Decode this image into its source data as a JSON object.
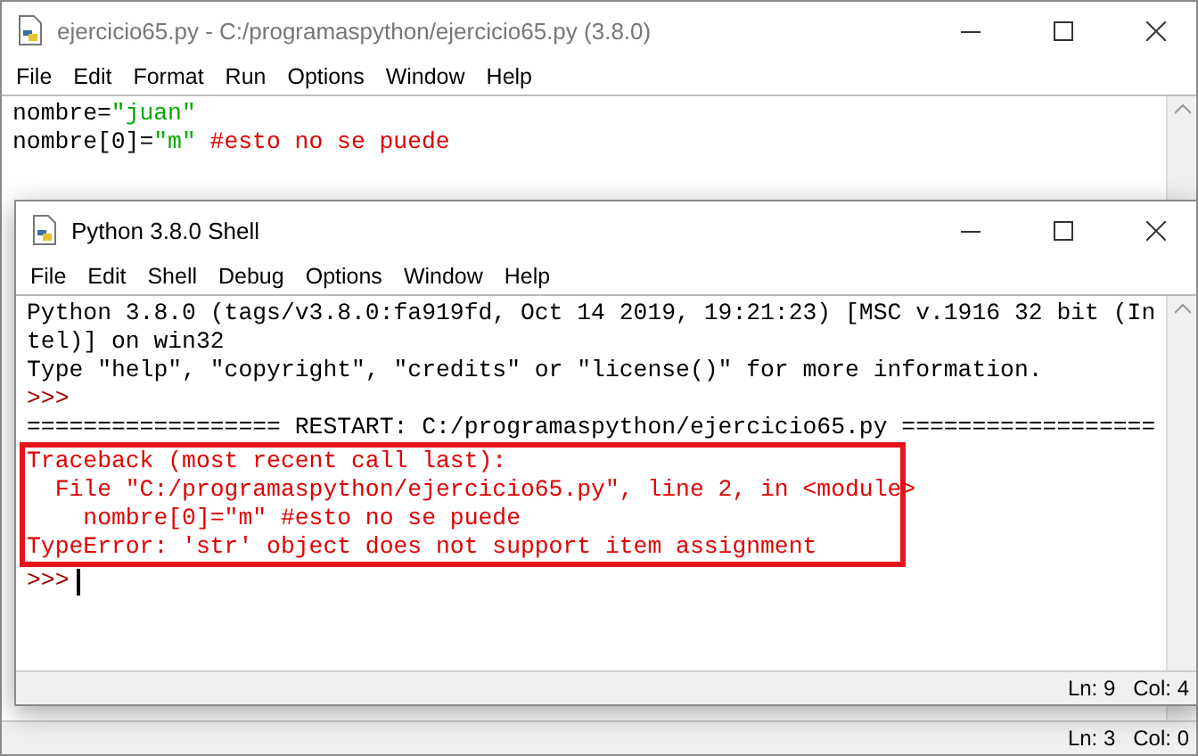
{
  "editor": {
    "title": "ejercicio65.py - C:/programaspython/ejercicio65.py (3.8.0)",
    "menu": [
      "File",
      "Edit",
      "Format",
      "Run",
      "Options",
      "Window",
      "Help"
    ],
    "code": [
      [
        {
          "kind": "plain",
          "text": "nombre="
        },
        {
          "kind": "string",
          "text": "\"juan\""
        }
      ],
      [
        {
          "kind": "plain",
          "text": "nombre[0]="
        },
        {
          "kind": "string",
          "text": "\"m\""
        },
        {
          "kind": "comment",
          "text": " #esto no se puede"
        }
      ]
    ],
    "status": {
      "line": "Ln: 3",
      "col": "Col: 0"
    }
  },
  "shell": {
    "title": "Python 3.8.0 Shell",
    "menu": [
      "File",
      "Edit",
      "Shell",
      "Debug",
      "Options",
      "Window",
      "Help"
    ],
    "lines": [
      {
        "kind": "output",
        "text": "Python 3.8.0 (tags/v3.8.0:fa919fd, Oct 14 2019, 19:21:23) [MSC v.1916 32 bit (In",
        "highlighted": false
      },
      {
        "kind": "output",
        "text": "tel)] on win32",
        "highlighted": false
      },
      {
        "kind": "output",
        "text": "Type \"help\", \"copyright\", \"credits\" or \"license()\" for more information.",
        "highlighted": false
      },
      {
        "kind": "prompt",
        "text": ">>>",
        "highlighted": false
      },
      {
        "kind": "output",
        "text": "================== RESTART: C:/programaspython/ejercicio65.py ==================",
        "highlighted": false
      },
      {
        "kind": "error",
        "text": "Traceback (most recent call last):",
        "highlighted": true
      },
      {
        "kind": "error",
        "text": "  File \"C:/programaspython/ejercicio65.py\", line 2, in <module>",
        "highlighted": true
      },
      {
        "kind": "error",
        "text": "    nombre[0]=\"m\" #esto no se puede",
        "highlighted": true
      },
      {
        "kind": "error",
        "text": "TypeError: 'str' object does not support item assignment",
        "highlighted": true
      },
      {
        "kind": "prompt",
        "text": ">>>",
        "highlighted": false,
        "cursor": true
      }
    ],
    "status": {
      "line": "Ln: 9",
      "col": "Col: 4"
    }
  }
}
